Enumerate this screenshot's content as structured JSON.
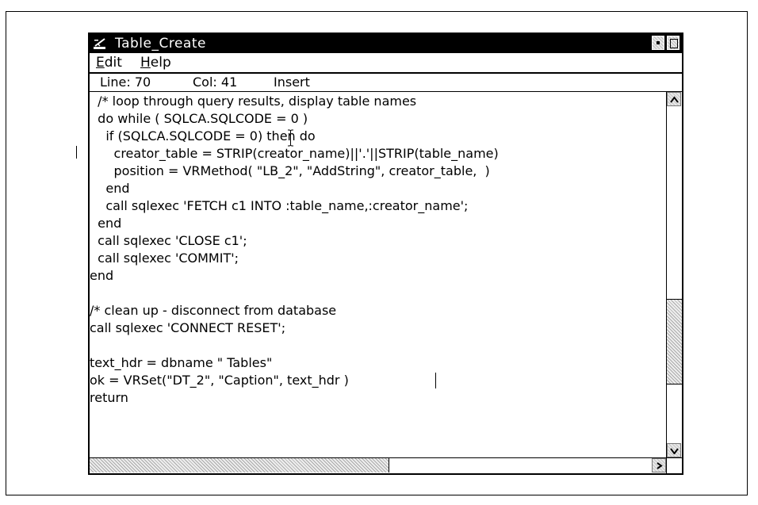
{
  "window": {
    "title": "Table_Create"
  },
  "menu": {
    "edit": {
      "first": "E",
      "rest": "dit"
    },
    "help": {
      "first": "H",
      "rest": "elp"
    }
  },
  "status": {
    "line": "Line: 70",
    "col": "Col: 41",
    "mode": "Insert"
  },
  "code": {
    "lines": [
      "  /* loop through query results, display table names",
      "  do while ( SQLCA.SQLCODE = 0 )",
      "    if (SQLCA.SQLCODE = 0) then do",
      "      creator_table = STRIP(creator_name)||'.'||STRIP(table_name)",
      "      position = VRMethod( \"LB_2\", \"AddString\", creator_table,  )",
      "    end",
      "    call sqlexec 'FETCH c1 INTO :table_name,:creator_name';",
      "  end",
      "  call sqlexec 'CLOSE c1';",
      "  call sqlexec 'COMMIT';",
      "end",
      "",
      "/* clean up - disconnect from database",
      "call sqlexec 'CONNECT RESET';",
      "",
      "text_hdr = dbname \" Tables\"",
      "ok = VRSet(\"DT_2\", \"Caption\", text_hdr )",
      "return"
    ]
  },
  "icons": {
    "system_menu": "system-menu-icon",
    "minimize": "minimize-icon",
    "maximize": "maximize-icon",
    "scroll_up": "arrow-up-icon",
    "scroll_down": "arrow-down-icon",
    "scroll_left": "arrow-left-icon",
    "scroll_right": "arrow-right-icon",
    "mouse_cursor": "i-beam-cursor-icon"
  },
  "colors": {
    "titlebar_bg": "#000000",
    "titlebar_fg": "#ffffff",
    "text": "#000000",
    "background": "#ffffff"
  }
}
